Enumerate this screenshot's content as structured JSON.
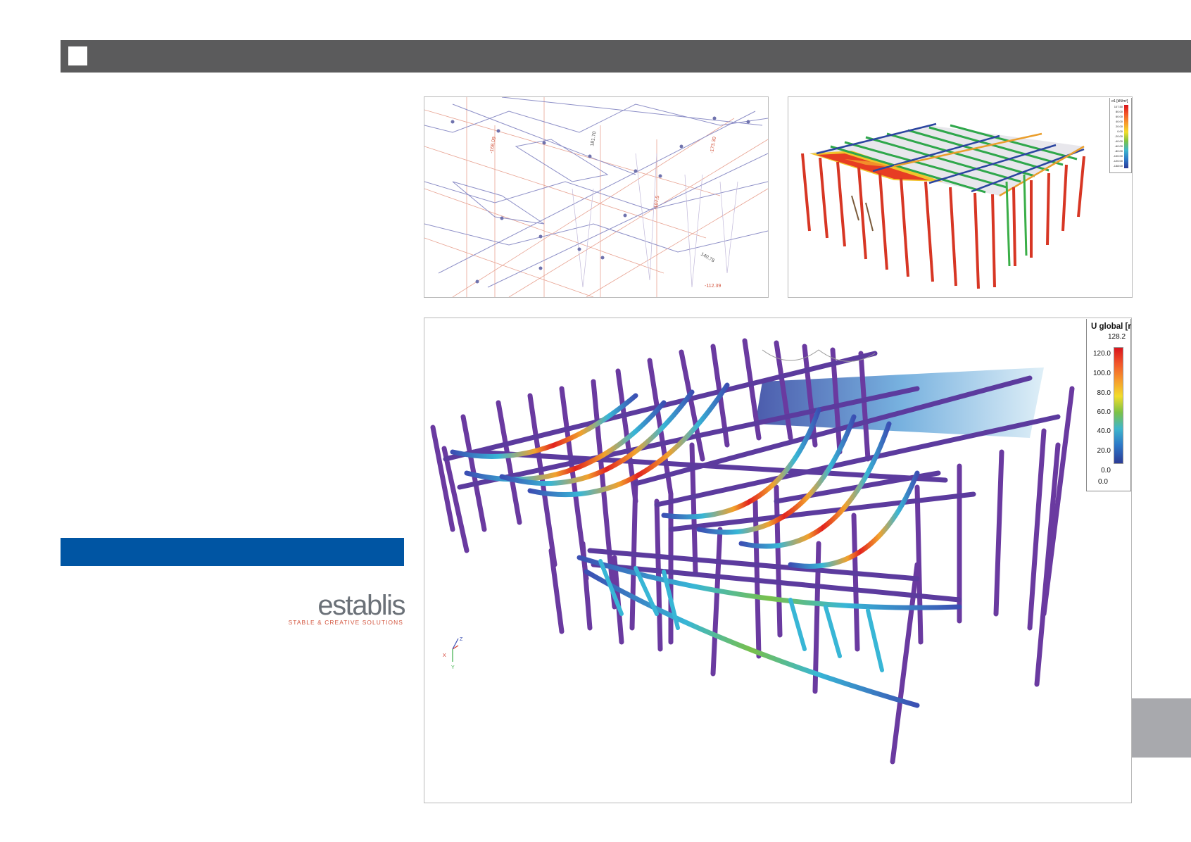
{
  "logo": {
    "wordmark": "establis",
    "tagline": "STABLE & CREATIVE SOLUTIONS"
  },
  "colors": {
    "header": "#5b5b5c",
    "accent_blue": "#0055a3",
    "side_tab": "#a8a9ad",
    "logo_grey": "#6b7178",
    "logo_red": "#d2533c"
  },
  "figures": {
    "top_left": {
      "labels": [
        "-168.09",
        "181.70",
        "-173.30",
        "-107.5",
        "140.78",
        "-112.39"
      ]
    },
    "top_right": {
      "legend_title": "σ1 [kN/m²]",
      "legend_ticks": [
        "107.50",
        "80.00",
        "60.00",
        "40.00",
        "20.00",
        "0.00",
        "-20.00",
        "-40.00",
        "-60.00",
        "-80.00",
        "-100.00",
        "-120.00",
        "-138.00"
      ]
    },
    "main": {
      "legend_title": "U global [mm]",
      "legend_max": "128.2",
      "legend_ticks": [
        "120.0",
        "100.0",
        "80.0",
        "60.0",
        "40.0",
        "20.0",
        "0.0"
      ],
      "legend_min": "0.0",
      "axis_labels": {
        "x": "X",
        "y": "Y",
        "z": "Z"
      }
    }
  }
}
